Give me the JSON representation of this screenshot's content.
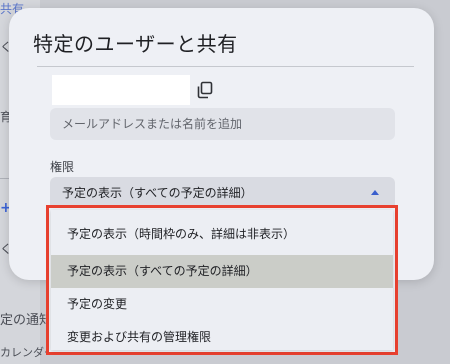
{
  "background": {
    "fragment_1": "共有",
    "fragment_2": "く",
    "fragment_3": "育",
    "fragment_4": "+",
    "fragment_5": "く",
    "fragment_6": "定の通知",
    "fragment_7": "カレンダー"
  },
  "dialog": {
    "title": "特定のユーザーと共有",
    "email_placeholder": "メールアドレスまたは名前を追加",
    "permission_label": "権限",
    "selected_value": "予定の表示（すべての予定の詳細）",
    "icons": {
      "copy": "copy-icon",
      "dropdown_arrow": "arrow-up-icon"
    }
  },
  "dropdown": {
    "options": [
      "予定の表示（時間枠のみ、詳細は非表示）",
      "予定の表示（すべての予定の詳細）",
      "予定の変更",
      "変更および共有の管理権限"
    ],
    "selected_index": 1,
    "highlight_color": "#e8402f"
  }
}
